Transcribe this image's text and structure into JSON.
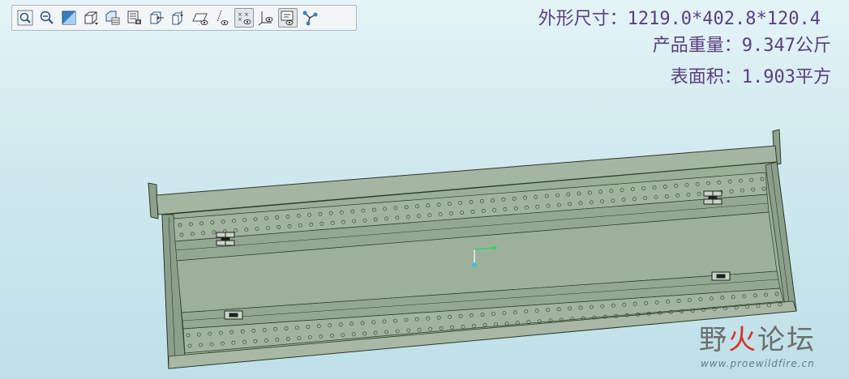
{
  "toolbar": {
    "buttons": [
      {
        "name": "zoom-fit-icon"
      },
      {
        "name": "zoom-out-icon"
      },
      {
        "name": "view-shaded-icon"
      },
      {
        "name": "view-orient-icon"
      },
      {
        "name": "saved-views-icon"
      },
      {
        "name": "layers-icon"
      },
      {
        "name": "spin-center-icon"
      },
      {
        "name": "repaint-icon"
      },
      {
        "name": "plane-display-icon"
      },
      {
        "name": "axis-display-icon"
      },
      {
        "name": "point-display-icon"
      },
      {
        "name": "csys-display-icon"
      },
      {
        "name": "annotation-display-icon"
      },
      {
        "name": "model-tree-icon"
      }
    ]
  },
  "info": {
    "dimensions": "外形尺寸：1219.0*402.8*120.4",
    "weight": "产品重量：9.347公斤",
    "area": "表面积：1.903平方"
  },
  "watermark": {
    "name_part1": "野",
    "name_part2": "火",
    "name_part3": "论坛",
    "url": "www.proewildfire.cn"
  },
  "colors": {
    "model_body": "#9aae98",
    "model_edge": "#2c3a2c",
    "watermark_accent": "#d8322a"
  }
}
